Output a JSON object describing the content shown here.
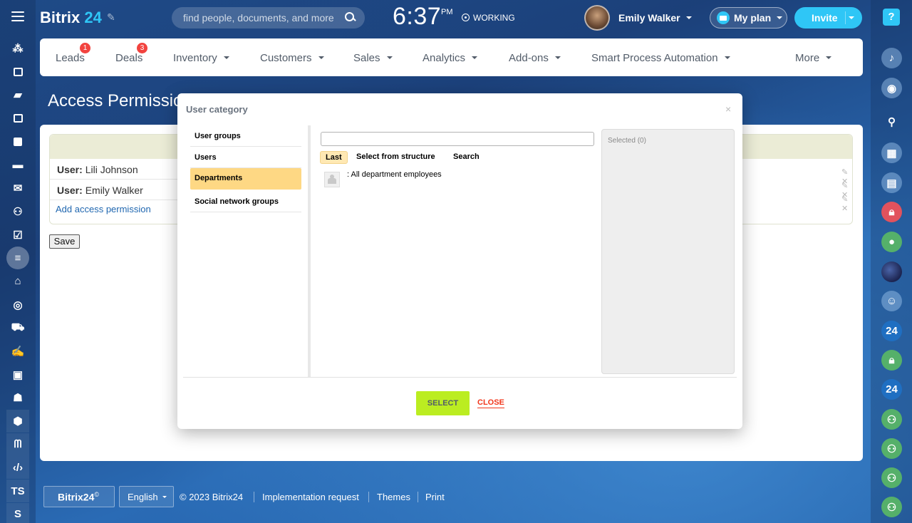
{
  "header": {
    "logo_text": "Bitrix",
    "logo_num": "24",
    "search_placeholder": "find people, documents, and more",
    "clock": "6:37",
    "clock_ampm": "PM",
    "status": "WORKING",
    "user_name": "Emily Walker",
    "plan_label": "My plan",
    "invite_label": "Invite"
  },
  "left_sidebar": {
    "icons": [
      "activity-icon",
      "news-icon",
      "chat-icon",
      "calendar-icon",
      "document-icon",
      "drive-icon",
      "mail-icon",
      "group-icon",
      "tasks-icon",
      "crm-funnel-icon",
      "store-icon",
      "target-icon",
      "cart-icon",
      "sign-icon",
      "contact-card-icon",
      "robot-icon",
      "box-icon",
      "automation-icon",
      "developer-icon"
    ],
    "text_items": [
      "TS",
      "S"
    ]
  },
  "nav": {
    "items": [
      {
        "label": "Leads",
        "badge": "1"
      },
      {
        "label": "Deals",
        "badge": "3"
      },
      {
        "label": "Inventory",
        "caret": true
      },
      {
        "label": "Customers",
        "caret": true
      },
      {
        "label": "Sales",
        "caret": true
      },
      {
        "label": "Analytics",
        "caret": true
      },
      {
        "label": "Add-ons",
        "caret": true
      },
      {
        "label": "Smart Process Automation",
        "caret": true
      },
      {
        "label": "More",
        "caret": true
      }
    ]
  },
  "page": {
    "title": "Access Permissions",
    "rows": [
      {
        "label": "User:",
        "name": "Lili Johnson"
      },
      {
        "label": "User:",
        "name": "Emily Walker"
      }
    ],
    "add_link": "Add access permission",
    "save_label": "Save"
  },
  "modal": {
    "title": "User category",
    "close_glyph": "×",
    "categories": [
      "User groups",
      "Users",
      "Departments",
      "Social network groups"
    ],
    "active_category": "Departments",
    "search_value": "",
    "tabs": [
      "Last",
      "Select from structure",
      "Search"
    ],
    "active_tab": "Last",
    "result_item": ": All department employees",
    "selected_label": "Selected (0)",
    "select_label": "SELECT",
    "close_label": "CLOSE"
  },
  "right_bar": {
    "help": "?",
    "num_label": "24"
  },
  "footer": {
    "logo": "Bitrix24",
    "logo_mark": "©",
    "language": "English",
    "copyright": "© 2023 Bitrix24",
    "links": [
      "Implementation request",
      "Themes",
      "Print"
    ]
  },
  "colors": {
    "accent": "#2fc6f6",
    "select_button": "#bbed21",
    "close_link": "#f1361b",
    "active_category": "#fed884",
    "badge": "#f2433f"
  }
}
